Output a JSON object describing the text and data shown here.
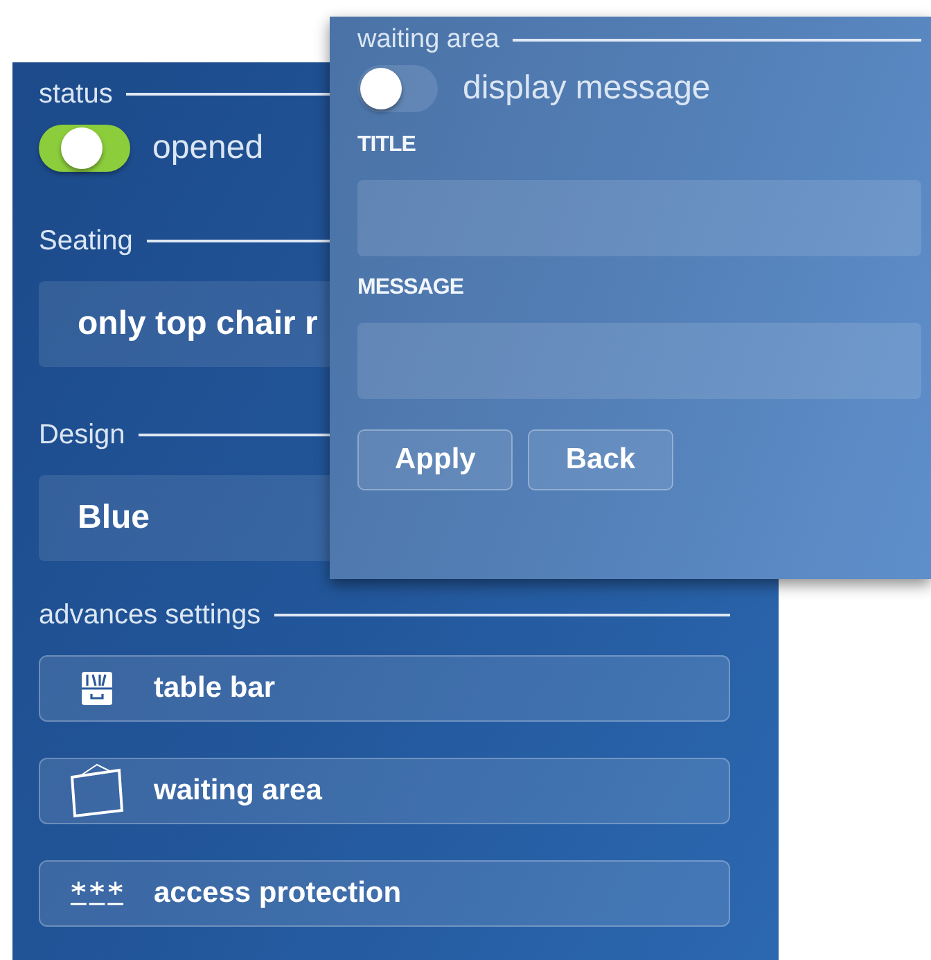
{
  "main_panel": {
    "sections": [
      {
        "kind": "toggle",
        "heading": "status",
        "toggle": {
          "label": "opened",
          "on": true
        }
      },
      {
        "kind": "select",
        "heading": "Seating",
        "value": "only top chair r"
      },
      {
        "kind": "select",
        "heading": "Design",
        "value": "Blue"
      },
      {
        "kind": "buttons",
        "heading": "advances settings",
        "buttons": [
          "table bar",
          "waiting area",
          "access protection"
        ]
      }
    ]
  },
  "waiting_area_dialog": {
    "heading": "waiting area",
    "toggle": {
      "label": "display message",
      "on": false
    },
    "fields": [
      {
        "label": "TITLE"
      },
      {
        "label": "MESSAGE"
      }
    ],
    "buttons": [
      "Apply",
      "Back"
    ]
  }
}
